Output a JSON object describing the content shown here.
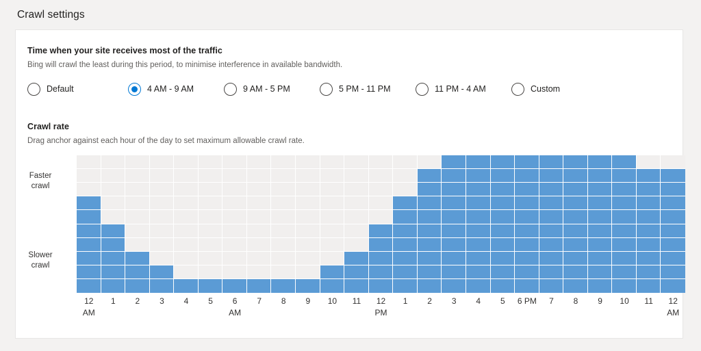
{
  "page_title": "Crawl settings",
  "traffic": {
    "heading": "Time when your site receives most of the traffic",
    "description": "Bing will crawl the least during this period, to minimise interference in available bandwidth.",
    "options": [
      {
        "label": "Default",
        "selected": false
      },
      {
        "label": "4 AM - 9 AM",
        "selected": true
      },
      {
        "label": "9 AM - 5 PM",
        "selected": false
      },
      {
        "label": "5 PM - 11 PM",
        "selected": false
      },
      {
        "label": "11 PM - 4 AM",
        "selected": false
      },
      {
        "label": "Custom",
        "selected": false
      }
    ]
  },
  "crawl_rate": {
    "heading": "Crawl rate",
    "description": "Drag anchor against each hour of the day to set maximum allowable crawl rate.",
    "axis_top_label": "Faster\ncrawl",
    "axis_top_line1": "Faster",
    "axis_top_line2": "crawl",
    "axis_bottom_line1": "Slower",
    "axis_bottom_line2": "crawl"
  },
  "chart_data": {
    "type": "bar",
    "title": "Crawl rate",
    "xlabel": "",
    "ylabel": "",
    "grid": true,
    "legend": false,
    "rows": 10,
    "ylim": [
      0,
      10
    ],
    "y_axis_labels": {
      "high": "Faster crawl",
      "low": "Slower crawl"
    },
    "categories": [
      "12 AM",
      "1",
      "2",
      "3",
      "4",
      "5",
      "6 AM",
      "7",
      "8",
      "9",
      "10",
      "11",
      "12 PM",
      "1",
      "2",
      "3",
      "4",
      "5",
      "6 PM",
      "7",
      "8",
      "9",
      "10",
      "11",
      "12 AM"
    ],
    "tick_labels": [
      {
        "main": "12",
        "suffix": "AM"
      },
      {
        "main": "1",
        "suffix": ""
      },
      {
        "main": "2",
        "suffix": ""
      },
      {
        "main": "3",
        "suffix": ""
      },
      {
        "main": "4",
        "suffix": ""
      },
      {
        "main": "5",
        "suffix": ""
      },
      {
        "main": "6",
        "suffix": "AM"
      },
      {
        "main": "7",
        "suffix": ""
      },
      {
        "main": "8",
        "suffix": ""
      },
      {
        "main": "9",
        "suffix": ""
      },
      {
        "main": "10",
        "suffix": ""
      },
      {
        "main": "11",
        "suffix": ""
      },
      {
        "main": "12",
        "suffix": "PM"
      },
      {
        "main": "1",
        "suffix": ""
      },
      {
        "main": "2",
        "suffix": ""
      },
      {
        "main": "3",
        "suffix": ""
      },
      {
        "main": "4",
        "suffix": ""
      },
      {
        "main": "5",
        "suffix": ""
      },
      {
        "main": "6 PM",
        "suffix": ""
      },
      {
        "main": "7",
        "suffix": ""
      },
      {
        "main": "8",
        "suffix": ""
      },
      {
        "main": "9",
        "suffix": ""
      },
      {
        "main": "10",
        "suffix": ""
      },
      {
        "main": "11",
        "suffix": ""
      },
      {
        "main": "12",
        "suffix": "AM"
      }
    ],
    "values": [
      7,
      5,
      3,
      2,
      1,
      1,
      1,
      1,
      1,
      1,
      2,
      3,
      5,
      7,
      9,
      10,
      10,
      10,
      10,
      10,
      10,
      10,
      10,
      9,
      9
    ]
  },
  "colors": {
    "accent": "#0078d4",
    "bar": "#5b9bd5",
    "cell_empty": "#f1efee",
    "page_bg": "#f3f2f1",
    "card_bg": "#ffffff",
    "text": "#201f1e",
    "text_secondary": "#605e5c"
  }
}
